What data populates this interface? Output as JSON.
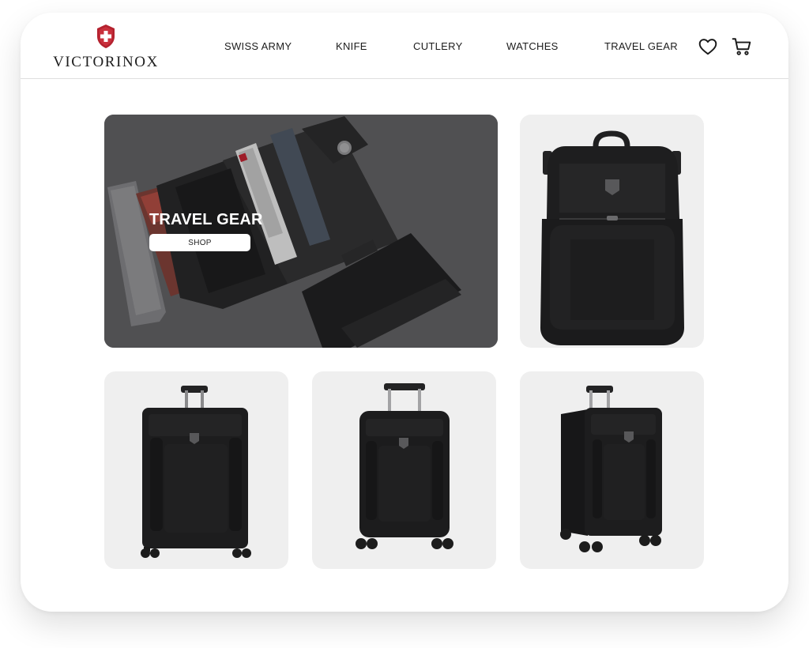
{
  "brand": {
    "name": "VICTORINOX",
    "accent_color": "#b4222f"
  },
  "nav": {
    "items": [
      {
        "label": "SWISS ARMY"
      },
      {
        "label": "KNIFE"
      },
      {
        "label": "CUTLERY"
      },
      {
        "label": "WATCHES"
      },
      {
        "label": "TRAVEL GEAR"
      }
    ],
    "icons": [
      "heart-icon",
      "cart-icon"
    ]
  },
  "hero": {
    "title": "TRAVEL GEAR",
    "button_label": "SHOP",
    "image": "wallet-and-cardholder-image"
  },
  "products": [
    {
      "image": "backpack-image"
    },
    {
      "image": "large-suitcase-image"
    },
    {
      "image": "carry-on-suitcase-image"
    },
    {
      "image": "expandable-suitcase-image"
    }
  ]
}
